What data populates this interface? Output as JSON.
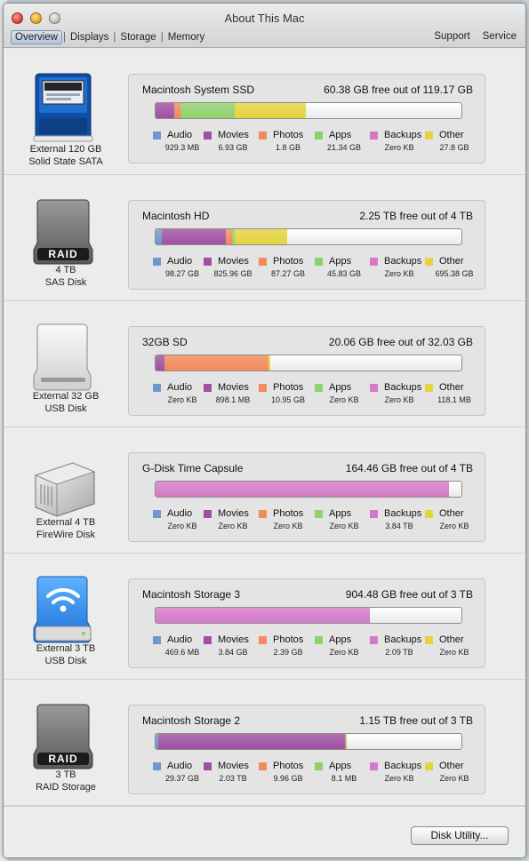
{
  "window": {
    "title": "About This Mac",
    "tabs": [
      "Overview",
      "Displays",
      "Storage",
      "Memory"
    ],
    "right_tabs": [
      "Support",
      "Service"
    ]
  },
  "legend": {
    "labels": [
      "Audio",
      "Movies",
      "Photos",
      "Apps",
      "Backups",
      "Other"
    ],
    "colors": [
      "#6f97cc",
      "#a04fa2",
      "#f28a5c",
      "#8fd16c",
      "#d479c8",
      "#e4d43d"
    ]
  },
  "devices": [
    {
      "icon": "ssd-drive-icon",
      "caption": [
        "External 120 GB",
        "Solid State SATA"
      ],
      "volume": "Macintosh System SSD",
      "free_text": "60.38 GB free out of 119.17 GB",
      "usage_percent": [
        0.0,
        6.0,
        2.0,
        18.0,
        0.0,
        23.0
      ],
      "values": [
        "929.3 MB",
        "6.93 GB",
        "1.8 GB",
        "21.34 GB",
        "Zero KB",
        "27.8 GB"
      ]
    },
    {
      "icon": "raid-drive-icon",
      "caption": [
        "4 TB",
        "SAS Disk"
      ],
      "volume": "Macintosh HD",
      "free_text": "2.25 TB free out of 4 TB",
      "usage_percent": [
        2.0,
        21.0,
        2.0,
        1.0,
        0.0,
        17.0
      ],
      "values": [
        "98.27 GB",
        "825.96 GB",
        "87.27 GB",
        "45.83 GB",
        "Zero KB",
        "695.38 GB"
      ]
    },
    {
      "icon": "usb-drive-icon",
      "caption": [
        "External 32 GB",
        "USB Disk"
      ],
      "volume": "32GB SD",
      "free_text": "20.06 GB free out of 32.03 GB",
      "usage_percent": [
        0.0,
        3.0,
        34.0,
        0.0,
        0.0,
        0.5
      ],
      "values": [
        "Zero KB",
        "898.1 MB",
        "10.95 GB",
        "Zero KB",
        "Zero KB",
        "118.1 MB"
      ]
    },
    {
      "icon": "firewire-drive-icon",
      "caption": [
        "External 4 TB",
        "FireWire Disk"
      ],
      "volume": "G-Disk Time Capsule",
      "free_text": "164.46 GB free out of 4 TB",
      "usage_percent": [
        0.0,
        0.0,
        0.0,
        0.0,
        96.0,
        0.0
      ],
      "values": [
        "Zero KB",
        "Zero KB",
        "Zero KB",
        "Zero KB",
        "3.84 TB",
        "Zero KB"
      ]
    },
    {
      "icon": "wifi-drive-icon",
      "caption": [
        "External 3 TB",
        "USB Disk"
      ],
      "volume": "Macintosh Storage 3",
      "free_text": "904.48 GB free out of 3 TB",
      "usage_percent": [
        0.0,
        0.0,
        0.0,
        0.0,
        70.0,
        0.0
      ],
      "values": [
        "469.6 MB",
        "3.84 GB",
        "2.39 GB",
        "Zero KB",
        "2.09 TB",
        "Zero KB"
      ]
    },
    {
      "icon": "raid-drive-icon",
      "caption": [
        "3 TB",
        "RAID Storage"
      ],
      "volume": "Macintosh Storage 2",
      "free_text": "1.15 TB free out of 3 TB",
      "usage_percent": [
        1.0,
        61.0,
        0.3,
        0.3,
        0.0,
        0.0
      ],
      "values": [
        "29.37 GB",
        "2.03 TB",
        "9.96 GB",
        "8.1 MB",
        "Zero KB",
        "Zero KB"
      ]
    }
  ],
  "footer": {
    "disk_utility_label": "Disk Utility..."
  },
  "raid_badge": "RAID"
}
